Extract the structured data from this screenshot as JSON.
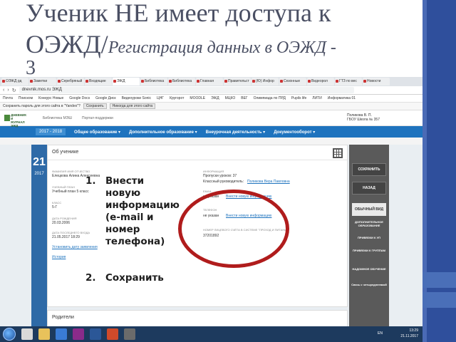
{
  "slide": {
    "title_line1": "Ученик НЕ имеет доступа к",
    "title_line2_main": "ОЭЖД/",
    "title_line2_sub": "Регистрация данных в ОЭЖД -",
    "title_line3": "3"
  },
  "browser": {
    "tabs": [
      "ОЭЖД рд",
      "Заметки",
      "Серебряный",
      "Входящие",
      "ЭЖД",
      "Библиотека",
      "Библиотека",
      "Главная",
      "Правительст",
      "(Ю) Инфор",
      "Сезонные",
      "Видеорол",
      "ГТЗ по вес",
      "Новости"
    ],
    "url": "dnevnik.mos.ru  ЭЖД",
    "bookmarks": [
      "Почта",
      "Поиском",
      "Конкурс Новые",
      "Google Docs",
      "Google Диск",
      "Видеоуроки Sonic",
      "ЦНГ",
      "Кругорот",
      "MOODLE",
      "ЭЖД",
      "МЦКО",
      "ВЕГ",
      "Олимпиада по ПРД",
      "Pupils life",
      "ЛИТИ",
      "Информатика 01"
    ],
    "password_prompt": "Сохранить пароль для этого сайта в \"Yandex\"?",
    "password_save": "Сохранить",
    "password_never": "Никогда для этого сайта"
  },
  "site": {
    "logo_text": "ДНЕВНИК И ЖУРНАЛ ЭЖД",
    "nav_link1": "Библиотека МЭШ",
    "nav_link2": "Портал-поддержки",
    "user_name": "Поликова В. П.",
    "user_sub": "ГБОУ Школа № 357",
    "year": "2017 - 2018",
    "menu": [
      "Общее образование",
      "Дополнительное образование",
      "Внеурочная деятельность",
      "Документооборот"
    ]
  },
  "profile": {
    "date_day": "21",
    "date_year": "2017",
    "card_title": "Об ученике",
    "fields": [
      {
        "label": "ФАМИЛИЯ ИМЯ ОТЧЕСТВО",
        "value": "Елецкова Алина Алексеевна"
      },
      {
        "label": "УЧЕБНЫЙ ПЛАН",
        "value": "Учебный план 5 класс"
      },
      {
        "label": "КЛАСС",
        "value": "5-Г"
      },
      {
        "label": "ДАТА РОЖДЕНИЯ",
        "value": "20.03.2006"
      },
      {
        "label": "ДАТА ПОСЛЕДНЕГО ВХОДА",
        "value": "21.05.2017 18:29"
      }
    ],
    "link_set_date": "Установить дату заявления",
    "link_history": "История",
    "info_label": "ИНФОРМАЦИЯ",
    "info_missed": "Пропуски уроков: 37",
    "info_teacher_label": "Классный руководитель:",
    "info_teacher": "Поликова Вера Павловна",
    "email_label": "EMAIL",
    "email_value": "не указан",
    "email_link": "Внести новую информацию",
    "phone_label": "ТЕЛЕФОН",
    "phone_value": "не указан",
    "phone_link": "Внести новую информацию",
    "account_label": "НОМЕР ЛИЦЕВОГО СЧЁТА В СИСТЕМЕ \"ПРОХОД И ПИТАНИЕ\"",
    "account_value": "37201892",
    "parents_title": "Родители"
  },
  "sidebar": {
    "save": "СОХРАНИТЬ",
    "back": "НАЗАД",
    "normal_view": "ОБЫЧНЫЙ ВИД",
    "items": [
      "ДОПОЛНИТЕЛЬНОЕ ОБРАЗОВАНИЕ",
      "ПРИВЯЗКИ К УП",
      "ПРИВЯЗКИ К ГРУППАМ",
      "НАДОМНОЕ ОБУЧЕНИЕ",
      "Связь с четыреднеевкой"
    ]
  },
  "annotation": {
    "num1": "1.",
    "text1": "Внести новую информацию (e-mail и номер телефона)",
    "num2": "2.",
    "text2": "Сохранить"
  },
  "taskbar": {
    "lang": "EN",
    "time": "13:29",
    "date": "21.11.2017"
  },
  "colors": {
    "nav_blue": "#1e73be",
    "ellipse_red": "#b01c1c",
    "band_blue": "#2f4f9c"
  }
}
